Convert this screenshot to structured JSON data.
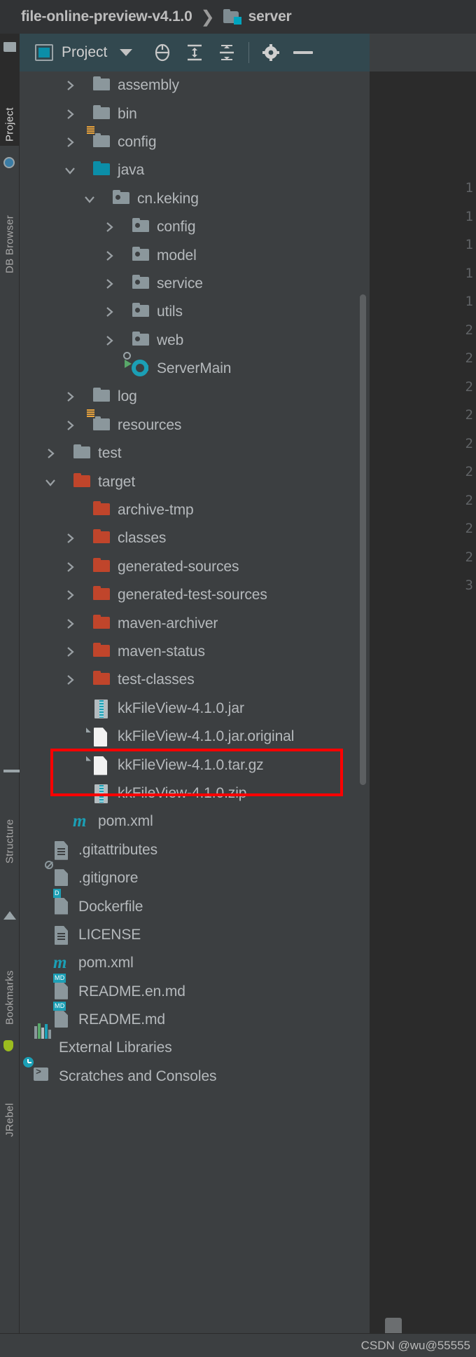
{
  "breadcrumb": {
    "project": "file-online-preview-v4.1.0",
    "separator": "❯",
    "module": "server",
    "module_icon": "module-folder-icon"
  },
  "sidebar": {
    "tabs": [
      {
        "label": "Project",
        "active": true,
        "icon": "folder-icon"
      },
      {
        "label": "DB Browser",
        "active": false,
        "icon": "database-icon"
      },
      {
        "label": "Structure",
        "active": false,
        "icon": "structure-icon"
      },
      {
        "label": "Bookmarks",
        "active": false,
        "icon": "bookmark-icon"
      },
      {
        "label": "JRebel",
        "active": false,
        "icon": "jrebel-rocket-icon"
      }
    ]
  },
  "toolwindow": {
    "title": "Project",
    "dropdown_icon": "chevron-down-icon",
    "actions": [
      {
        "name": "select-opened-file",
        "icon": "crosshair-icon"
      },
      {
        "name": "expand-all",
        "icon": "expand-all-icon"
      },
      {
        "name": "collapse-all",
        "icon": "collapse-all-icon"
      },
      {
        "name": "settings",
        "icon": "gear-icon"
      },
      {
        "name": "hide",
        "icon": "minus-icon"
      }
    ]
  },
  "tree": {
    "items": [
      {
        "label": "assembly",
        "indent": 0,
        "arrow": "right",
        "icon": "folder-gray"
      },
      {
        "label": "bin",
        "indent": 0,
        "arrow": "right",
        "icon": "folder-gray"
      },
      {
        "label": "config",
        "indent": 0,
        "arrow": "right",
        "icon": "folder-gray-resources"
      },
      {
        "label": "java",
        "indent": 0,
        "arrow": "down",
        "icon": "folder-teal-sources"
      },
      {
        "label": "cn.keking",
        "indent": 1,
        "arrow": "down",
        "icon": "package"
      },
      {
        "label": "config",
        "indent": 2,
        "arrow": "right",
        "icon": "package"
      },
      {
        "label": "model",
        "indent": 2,
        "arrow": "right",
        "icon": "package"
      },
      {
        "label": "service",
        "indent": 2,
        "arrow": "right",
        "icon": "package"
      },
      {
        "label": "utils",
        "indent": 2,
        "arrow": "right",
        "icon": "package"
      },
      {
        "label": "web",
        "indent": 2,
        "arrow": "right",
        "icon": "package"
      },
      {
        "label": "ServerMain",
        "indent": 2,
        "arrow": "none",
        "icon": "java-class-runnable"
      },
      {
        "label": "log",
        "indent": 0,
        "arrow": "right",
        "icon": "folder-gray"
      },
      {
        "label": "resources",
        "indent": 0,
        "arrow": "right",
        "icon": "folder-gray-resources"
      },
      {
        "label": "test",
        "indent": -1,
        "arrow": "right",
        "icon": "folder-gray"
      },
      {
        "label": "target",
        "indent": -1,
        "arrow": "down",
        "icon": "folder-red-excluded"
      },
      {
        "label": "archive-tmp",
        "indent": 0,
        "arrow": "none",
        "icon": "folder-red-excluded"
      },
      {
        "label": "classes",
        "indent": 0,
        "arrow": "right",
        "icon": "folder-red-excluded"
      },
      {
        "label": "generated-sources",
        "indent": 0,
        "arrow": "right",
        "icon": "folder-red-excluded"
      },
      {
        "label": "generated-test-sources",
        "indent": 0,
        "arrow": "right",
        "icon": "folder-red-excluded"
      },
      {
        "label": "maven-archiver",
        "indent": 0,
        "arrow": "right",
        "icon": "folder-red-excluded"
      },
      {
        "label": "maven-status",
        "indent": 0,
        "arrow": "right",
        "icon": "folder-red-excluded"
      },
      {
        "label": "test-classes",
        "indent": 0,
        "arrow": "right",
        "icon": "folder-red-excluded"
      },
      {
        "label": "kkFileView-4.1.0.jar",
        "indent": 0,
        "arrow": "none",
        "icon": "archive"
      },
      {
        "label": "kkFileView-4.1.0.jar.original",
        "indent": 0,
        "arrow": "none",
        "icon": "file"
      },
      {
        "label": "kkFileView-4.1.0.tar.gz",
        "indent": 0,
        "arrow": "none",
        "icon": "file",
        "highlighted": true
      },
      {
        "label": "kkFileView-4.1.0.zip",
        "indent": 0,
        "arrow": "none",
        "icon": "archive"
      },
      {
        "label": "pom.xml",
        "indent": -1,
        "arrow": "none",
        "icon": "maven"
      },
      {
        "label": ".gitattributes",
        "indent": -2,
        "arrow": "none",
        "icon": "doc"
      },
      {
        "label": ".gitignore",
        "indent": -2,
        "arrow": "none",
        "icon": "ignored-file"
      },
      {
        "label": "Dockerfile",
        "indent": -2,
        "arrow": "none",
        "icon": "docker",
        "badge": "D"
      },
      {
        "label": "LICENSE",
        "indent": -2,
        "arrow": "none",
        "icon": "doc"
      },
      {
        "label": "pom.xml",
        "indent": -2,
        "arrow": "none",
        "icon": "maven"
      },
      {
        "label": "README.en.md",
        "indent": -2,
        "arrow": "none",
        "icon": "markdown",
        "badge": "MD"
      },
      {
        "label": "README.md",
        "indent": -2,
        "arrow": "none",
        "icon": "markdown",
        "badge": "MD"
      },
      {
        "label": "External Libraries",
        "indent": -3,
        "arrow": "right",
        "icon": "libraries"
      },
      {
        "label": "Scratches and Consoles",
        "indent": -3,
        "arrow": "right",
        "icon": "scratches"
      }
    ]
  },
  "editor_gutter": {
    "line_numbers": [
      "1",
      "1",
      "1",
      "1",
      "1",
      "2",
      "2",
      "2",
      "2",
      "2",
      "2",
      "2",
      "2",
      "2",
      "3"
    ]
  },
  "highlight": {
    "color": "#ff0000",
    "target": "kkFileView-4.1.0.tar.gz"
  },
  "watermark": {
    "text": "CSDN @wu@55555"
  },
  "colors": {
    "panel_bg": "#3c3f41",
    "header_bg": "#32484f",
    "breadcrumb_bg": "#313335",
    "editor_bg": "#2b2b2b",
    "text": "#b5b9bc",
    "accent_teal": "#0b8ea8",
    "excluded_red": "#c0452b",
    "highlight_red": "#ff0000"
  }
}
